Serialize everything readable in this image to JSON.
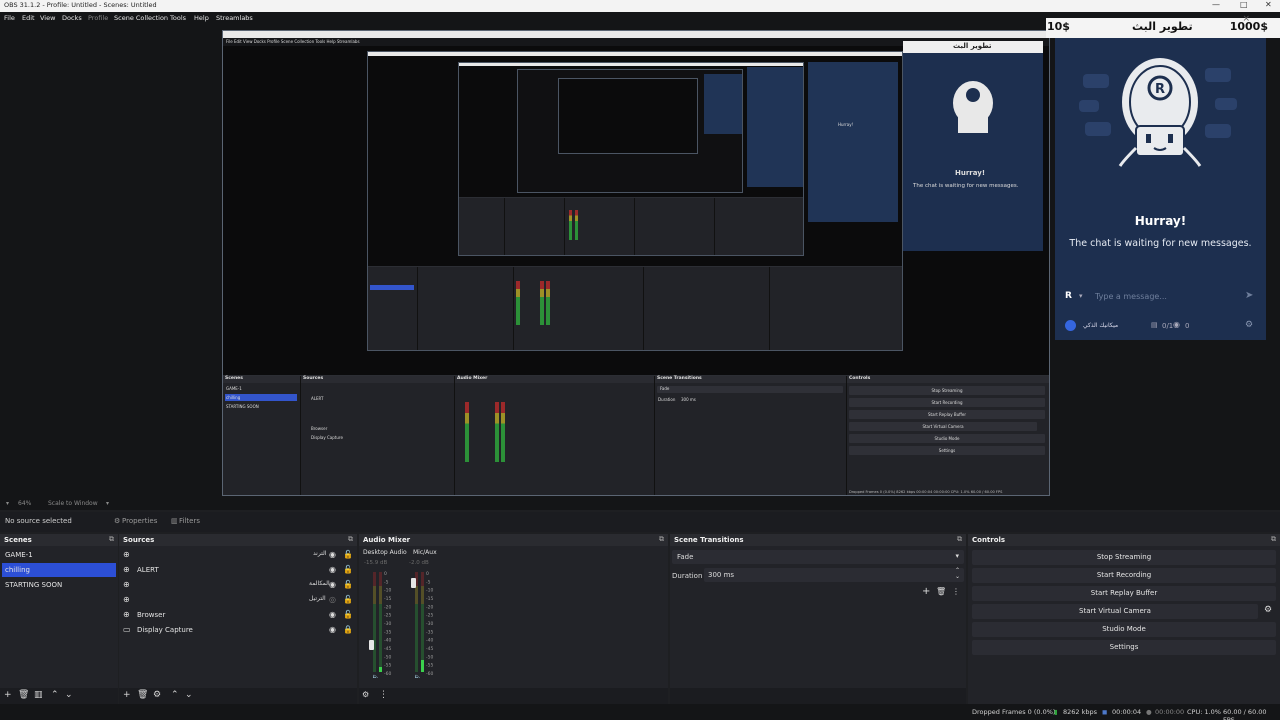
{
  "window": {
    "title": "OBS 31.1.2 - Profile: Untitled - Scenes: Untitled",
    "minimize": "—",
    "maximize": "□",
    "close": "✕"
  },
  "menu": [
    "File",
    "Edit",
    "View",
    "Docks",
    "Profile",
    "Scene Collection",
    "Tools",
    "Help",
    "Streamlabs"
  ],
  "chat_window": {
    "price_left": "10$",
    "title": "تطوير البث",
    "price_right": "1000$",
    "close": "×",
    "hurray": "Hurray!",
    "waiting": "The chat is waiting for new messages.",
    "input_placeholder": "Type a message...",
    "avatar_letter": "R",
    "user_name": "ميكانيك الذكي",
    "viewer_count": "0/1",
    "view_count": "0"
  },
  "nested_preview": {
    "scenes": [
      "GAME-1",
      "chilling",
      "STARTING SOON"
    ],
    "sources": [
      "ALERT",
      "Browser",
      "Display Capture"
    ],
    "controls": [
      "Stop Streaming",
      "Start Recording",
      "Start Replay Buffer",
      "Start Virtual Camera",
      "Studio Mode",
      "Settings"
    ],
    "transition": "Fade",
    "duration_label": "Duration",
    "duration": "300 ms",
    "no_source": "No source selected",
    "properties": "Properties",
    "filters": "Filters",
    "status": "Dropped Frames 0 (0.0%)   8262 kbps   00:00:04   00:00:00   CPU: 1.0%   60.00 / 60.00 FPS"
  },
  "zoom_bar": {
    "zoom": "64%",
    "scale": "Scale to Window"
  },
  "source_bar": {
    "no_source": "No source selected",
    "properties": "Properties",
    "filters": "Filters"
  },
  "scenes_dock": {
    "title": "Scenes",
    "items": [
      {
        "label": "GAME-1",
        "selected": false
      },
      {
        "label": "chilling",
        "selected": true
      },
      {
        "label": "STARTING SOON",
        "selected": false
      }
    ]
  },
  "sources_dock": {
    "title": "Sources",
    "items": [
      {
        "label": "",
        "arabic": "الترند",
        "icon": "browser-source-icon"
      },
      {
        "label": "ALERT",
        "arabic": "",
        "icon": "browser-source-icon"
      },
      {
        "label": "",
        "arabic": "المكالمة",
        "icon": "browser-source-icon"
      },
      {
        "label": "",
        "arabic": "الترتيل",
        "icon": "browser-source-icon"
      },
      {
        "label": "Browser",
        "arabic": "",
        "icon": "browser-source-icon"
      },
      {
        "label": "Display Capture",
        "arabic": "",
        "icon": "display-capture-icon"
      }
    ]
  },
  "audio_mixer": {
    "title": "Audio Mixer",
    "channels": [
      {
        "name": "Desktop Audio",
        "db": "-15.9 dB",
        "level": 0.28
      },
      {
        "name": "Mic/Aux",
        "db": "-2.0 dB",
        "level": 0.9
      }
    ],
    "scale": [
      "0",
      "-5",
      "-10",
      "-15",
      "-20",
      "-25",
      "-30",
      "-35",
      "-40",
      "-45",
      "-50",
      "-55",
      "-60"
    ]
  },
  "scene_transitions": {
    "title": "Scene Transitions",
    "transition": "Fade",
    "duration_label": "Duration",
    "duration": "300 ms"
  },
  "controls": {
    "title": "Controls",
    "buttons": [
      "Stop Streaming",
      "Start Recording",
      "Start Replay Buffer",
      "Start Virtual Camera",
      "Studio Mode",
      "Settings"
    ]
  },
  "status": {
    "dropped": "Dropped Frames 0 (0.0%)",
    "kbps": "8262 kbps",
    "stream_time": "00:00:04",
    "rec_time": "00:00:00",
    "cpu": "CPU: 1.0%",
    "fps": "60.00 / 60.00 FPS"
  },
  "colors": {
    "selection": "#2c4fd6",
    "chat_bg": "#1d2f4f",
    "meter_green": "#2ea43b",
    "meter_yellow": "#b3a426",
    "meter_red": "#b12a2a"
  }
}
